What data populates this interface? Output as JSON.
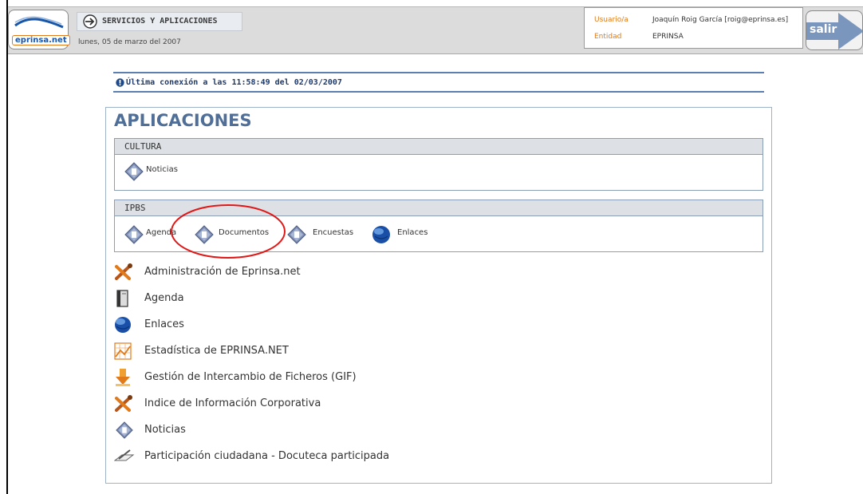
{
  "header": {
    "logo_text": "eprinsa.net",
    "section_title": "SERVICIOS Y APLICACIONES",
    "date": "lunes, 05 de marzo del 2007",
    "user_label": "Usuario/a",
    "user_value": "Joaquín Roig García [roig@eprinsa.es]",
    "entity_label": "Entidad",
    "entity_value": "EPRINSA",
    "logout_label": "salir"
  },
  "last_connection": "Última conexión a las 11:58:49 del 02/03/2007",
  "panel": {
    "title": "APLICACIONES",
    "groups": [
      {
        "name": "CULTURA",
        "items": [
          {
            "label": "Noticias",
            "icon": "news-icon"
          }
        ]
      },
      {
        "name": "IPBS",
        "items": [
          {
            "label": "Agenda",
            "icon": "news-icon"
          },
          {
            "label": "Documentos",
            "icon": "news-icon"
          },
          {
            "label": "Encuestas",
            "icon": "news-icon"
          },
          {
            "label": "Enlaces",
            "icon": "globe-icon"
          }
        ]
      }
    ],
    "apps": [
      {
        "label": "Administración de Eprinsa.net",
        "icon": "tools-icon"
      },
      {
        "label": "Agenda",
        "icon": "agenda-icon"
      },
      {
        "label": "Enlaces",
        "icon": "globe-icon"
      },
      {
        "label": "Estadística de EPRINSA.NET",
        "icon": "chart-icon"
      },
      {
        "label": "Gestión de Intercambio de Ficheros (GIF)",
        "icon": "download-arrow-icon"
      },
      {
        "label": "Indice de Información Corporativa",
        "icon": "tools-icon"
      },
      {
        "label": "Noticias",
        "icon": "news-icon"
      },
      {
        "label": "Participación ciudadana - Docuteca participada",
        "icon": "pen-paper-icon"
      }
    ]
  },
  "colors": {
    "accent_orange": "#e07a1a",
    "title_blue": "#4f6f98",
    "highlight_red": "#e01818"
  }
}
